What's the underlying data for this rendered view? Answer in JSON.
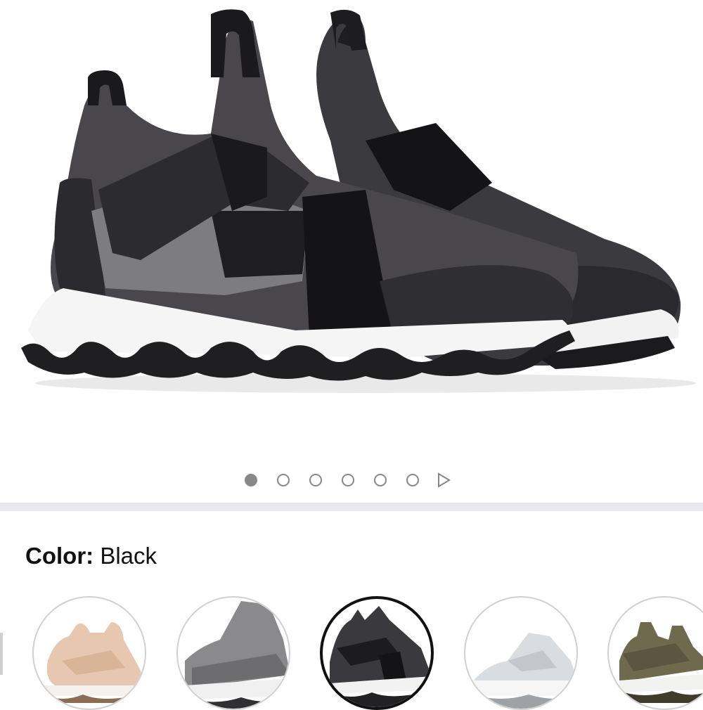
{
  "product_image": {
    "alt_icon": "sneaker-photo",
    "carousel": {
      "count": 6,
      "active_index": 0,
      "next_icon": "play-triangle-icon"
    }
  },
  "color_selector": {
    "label": "Color:",
    "value": "Black"
  },
  "swatches": [
    {
      "name": "rose-tan",
      "color": "#e8c7b0",
      "selected": false
    },
    {
      "name": "grey",
      "color": "#7a7a7c",
      "selected": false
    },
    {
      "name": "black",
      "color": "#3a3a3e",
      "selected": true
    },
    {
      "name": "white",
      "color": "#e4e6ea",
      "selected": false
    },
    {
      "name": "olive",
      "color": "#6f6a4e",
      "selected": false
    }
  ],
  "colors": {
    "divider": "#e7e9ec",
    "dot": "#888888"
  }
}
